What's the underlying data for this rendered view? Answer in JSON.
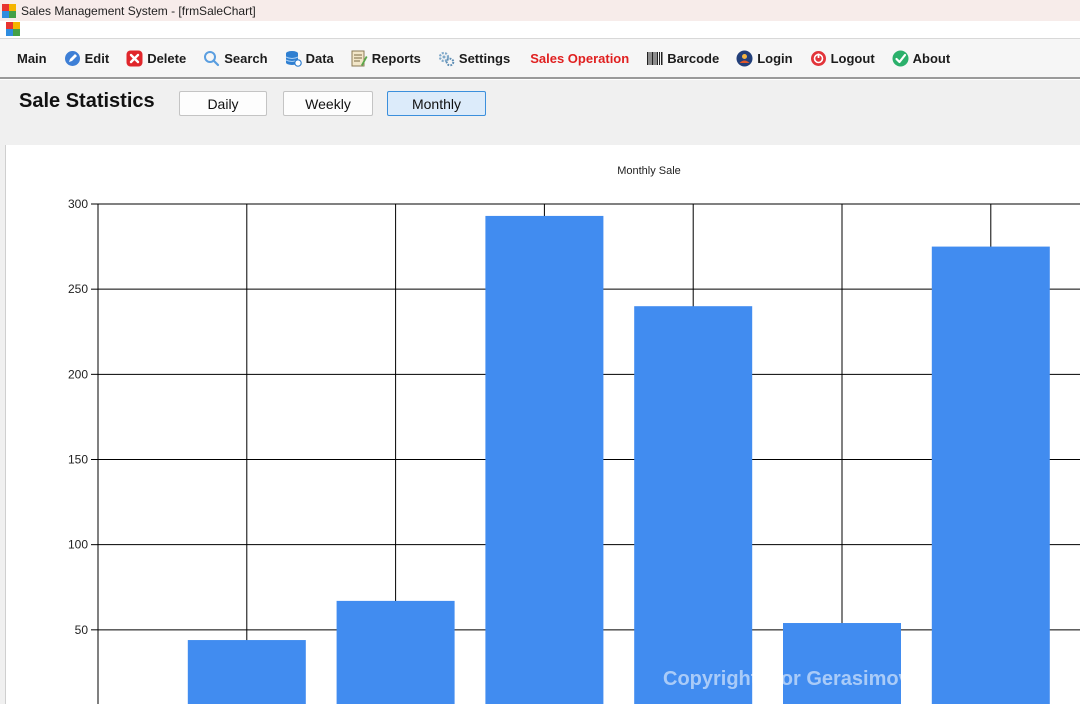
{
  "window": {
    "title": "Sales Management System - [frmSaleChart]"
  },
  "menu": [
    {
      "key": "main",
      "label": "Main",
      "icon": "none"
    },
    {
      "key": "edit",
      "label": "Edit",
      "icon": "pencil-icon"
    },
    {
      "key": "delete",
      "label": "Delete",
      "icon": "delete-icon"
    },
    {
      "key": "search",
      "label": "Search",
      "icon": "search-icon"
    },
    {
      "key": "data",
      "label": "Data",
      "icon": "database-icon"
    },
    {
      "key": "reports",
      "label": "Reports",
      "icon": "reports-icon"
    },
    {
      "key": "settings",
      "label": "Settings",
      "icon": "settings-icon"
    },
    {
      "key": "sales-operation",
      "label": "Sales Operation",
      "icon": "none"
    },
    {
      "key": "barcode",
      "label": "Barcode",
      "icon": "barcode-icon"
    },
    {
      "key": "login",
      "label": "Login",
      "icon": "login-icon"
    },
    {
      "key": "logout",
      "label": "Logout",
      "icon": "logout-icon"
    },
    {
      "key": "about",
      "label": "About",
      "icon": "check-icon"
    }
  ],
  "colors": {
    "bar": "#418cf0",
    "sales_operation": "#e02020",
    "grid": "#000000"
  },
  "page": {
    "title": "Sale Statistics",
    "buttons": {
      "daily": "Daily",
      "weekly": "Weekly",
      "monthly": "Monthly"
    },
    "selected": "monthly"
  },
  "chart_data": {
    "type": "bar",
    "title": "Monthly Sale",
    "xlabel": "",
    "ylabel": "",
    "yticks": [
      50,
      100,
      150,
      200,
      250,
      300
    ],
    "ylim": [
      0,
      300
    ],
    "grid": true,
    "legend": "none",
    "values": [
      44,
      67,
      293,
      240,
      54,
      275
    ]
  },
  "watermark": "Copyright Igor Gerasimov"
}
